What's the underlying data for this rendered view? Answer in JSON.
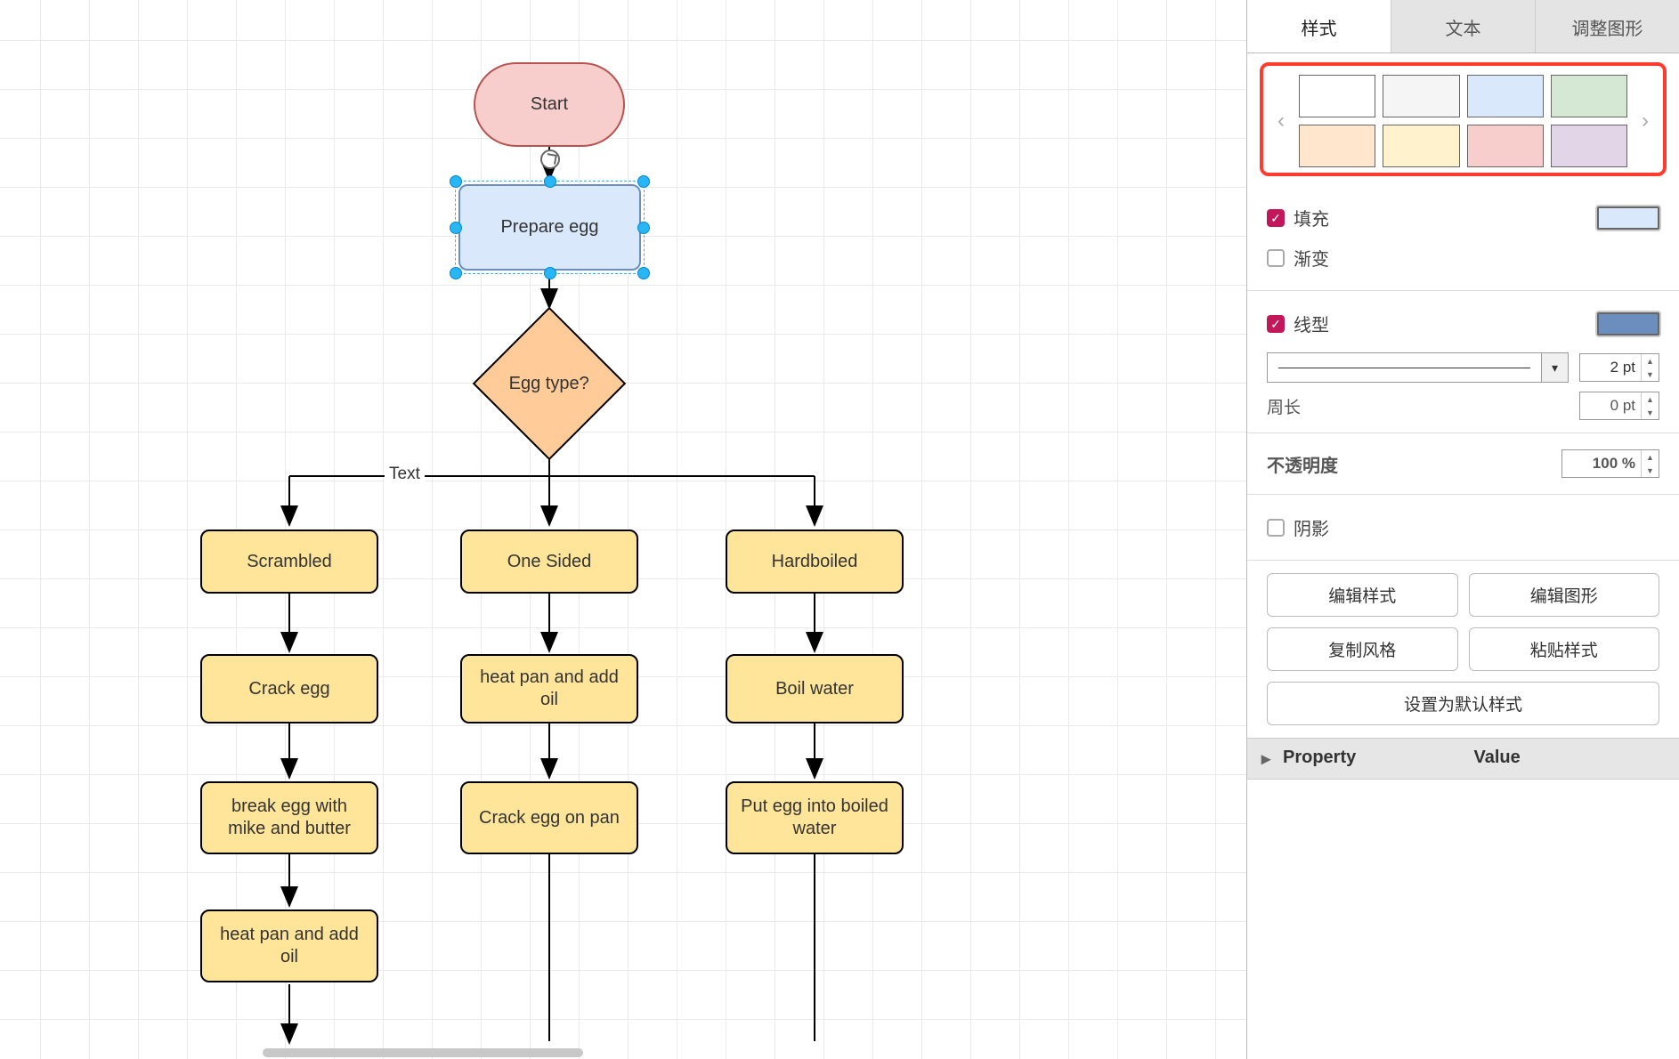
{
  "canvas": {
    "nodes": {
      "start": "Start",
      "prepare": "Prepare egg",
      "decision": "Egg type?",
      "scrambled": "Scrambled",
      "onesided": "One Sided",
      "hardboiled": "Hardboiled",
      "crack": "Crack egg",
      "heatpan": "heat pan and add oil",
      "boil": "Boil water",
      "breakegg": "break egg with mike and butter",
      "crackpan": "Crack egg on pan",
      "putegg": "Put egg into boiled water",
      "heatpan2": "heat pan and add oil"
    },
    "edge_labels": {
      "text": "Text"
    }
  },
  "panel": {
    "tabs": {
      "style": "样式",
      "text": "文本",
      "arrange": "调整图形"
    },
    "swatches": {
      "row": [
        "#FFFFFF",
        "#F5F5F5",
        "#DAE8FC",
        "#D5E8D4",
        "#FFE6CC",
        "#FFF2CC",
        "#F8CECC",
        "#E1D5E7"
      ]
    },
    "fill_label": "填充",
    "fill_color": "#DAE8FC",
    "gradient_label": "渐变",
    "line_label": "线型",
    "line_color": "#6C8EBF",
    "line_weight": "2 pt",
    "perimeter_label": "周长",
    "perimeter_value": "0 pt",
    "opacity_label": "不透明度",
    "opacity_value": "100 %",
    "shadow_label": "阴影",
    "buttons": {
      "edit_style": "编辑样式",
      "edit_shape": "编辑图形",
      "copy_style": "复制风格",
      "paste_style": "粘贴样式",
      "set_default": "设置为默认样式"
    },
    "prop_header": {
      "property": "Property",
      "value": "Value"
    }
  }
}
